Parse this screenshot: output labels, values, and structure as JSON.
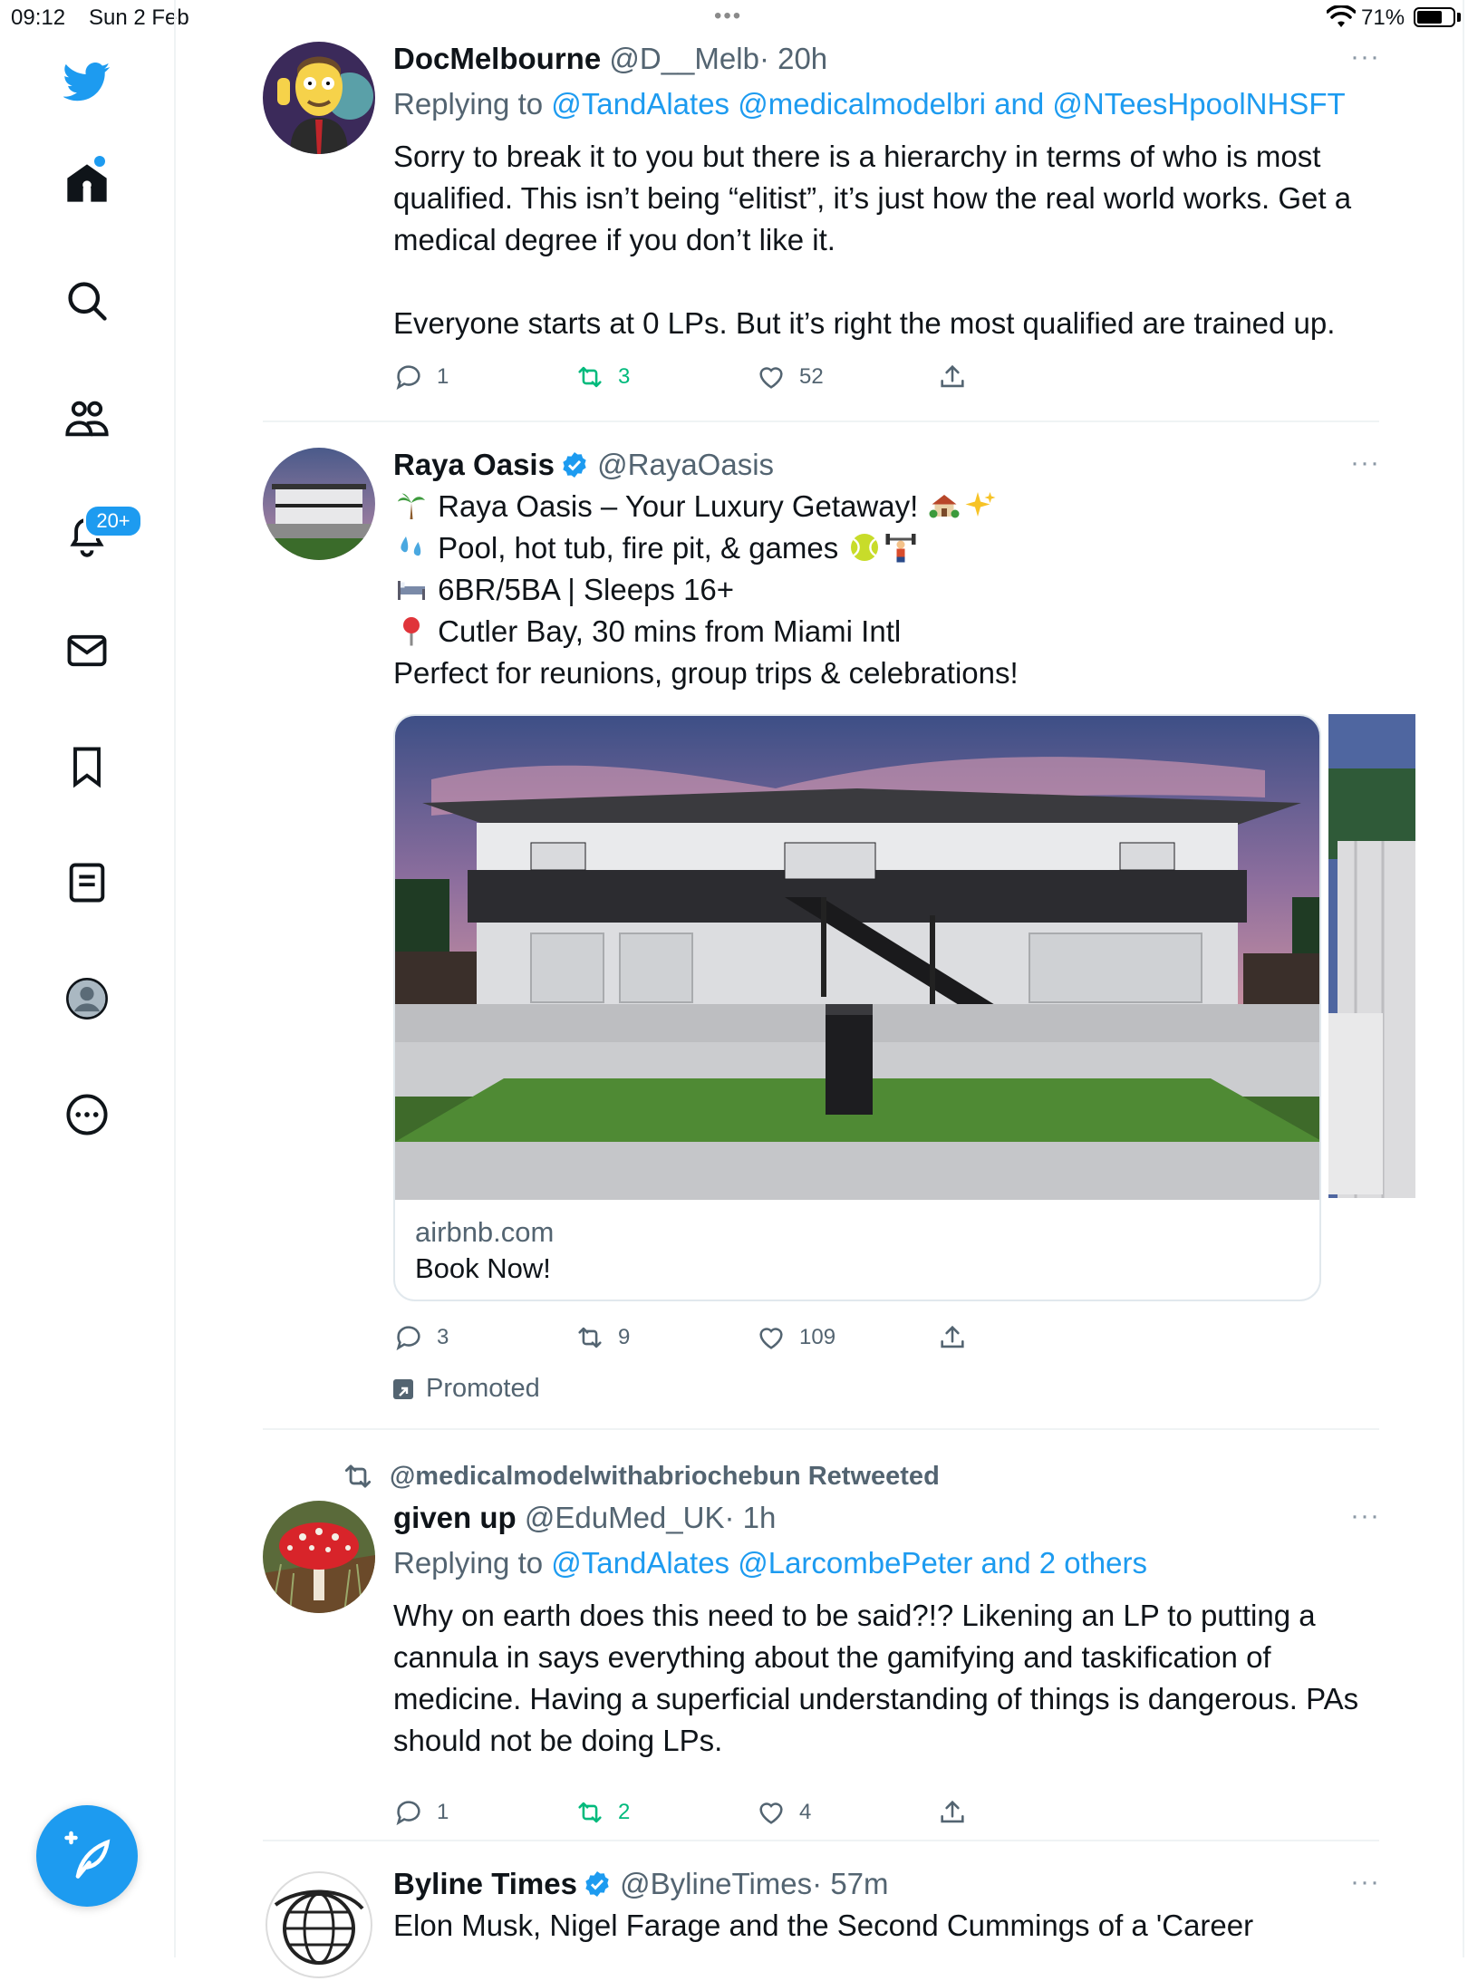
{
  "status_bar": {
    "time": "09:12",
    "date": "Sun 2 Feb",
    "battery": "71%",
    "battery_level": 0.71
  },
  "sidebar": {
    "items": [
      {
        "name": "twitter-logo-icon"
      },
      {
        "name": "home-icon"
      },
      {
        "name": "search-icon"
      },
      {
        "name": "communities-icon"
      },
      {
        "name": "notifications-icon"
      },
      {
        "name": "messages-icon"
      },
      {
        "name": "bookmarks-icon"
      },
      {
        "name": "lists-icon"
      },
      {
        "name": "profile-icon"
      },
      {
        "name": "more-icon"
      }
    ],
    "notifications_badge": "20+"
  },
  "colors": {
    "accent": "#1d9bf0",
    "retweet_green": "#00ba7c",
    "secondary_text": "#536471",
    "divider": "#eff3f4"
  },
  "tweets": [
    {
      "name": "DocMelbourne",
      "handle": "@D__Melb",
      "time": "· 20h",
      "more": "···",
      "replying_prefix": "Replying to",
      "replying_mentions": "@TandAlates @medicalmodelbri and @NTeesHpoolNHSFT",
      "body_p1": "Sorry to break it to you but there is a hierarchy in terms of who is most qualified. This isn’t being “elitist”, it’s just how the real world works. Get a medical degree if you don’t like it.",
      "body_p2": "Everyone starts at 0 LPs. But it’s right the most qualified are trained up.",
      "replies": "1",
      "retweets": "3",
      "likes": "52"
    },
    {
      "name": "Raya Oasis",
      "handle": "@RayaOasis",
      "more": "···",
      "line1": "Raya Oasis – Your Luxury Getaway!",
      "line2": "Pool, hot tub, fire pit, & games",
      "line3": "6BR/5BA | Sleeps 16+",
      "line4": "Cutler Bay, 30 mins from Miami Intl",
      "line5": "Perfect for reunions, group trips & celebrations!",
      "card_domain": "airbnb.com",
      "card_title": "Book Now!",
      "replies": "3",
      "retweets": "9",
      "likes": "109",
      "promoted": "Promoted"
    },
    {
      "retweeted_by": "@medicalmodelwithabriochebun Retweeted",
      "name": "given up",
      "handle": "@EduMed_UK",
      "time": "· 1h",
      "more": "···",
      "replying_prefix": "Replying to",
      "replying_mentions": "@TandAlates @LarcombePeter and 2 others",
      "body": "Why on earth does this need to be said?!? Likening an LP to putting a cannula in says everything about the gamifying and taskification of medicine. Having a superficial understanding of things is dangerous. PAs should not be doing LPs.",
      "replies": "1",
      "retweets": "2",
      "likes": "4"
    },
    {
      "name": "Byline Times",
      "handle": "@BylineTimes",
      "time": "· 57m",
      "more": "···",
      "body": "Elon Musk, Nigel Farage and the Second Cummings of a 'Career"
    }
  ]
}
